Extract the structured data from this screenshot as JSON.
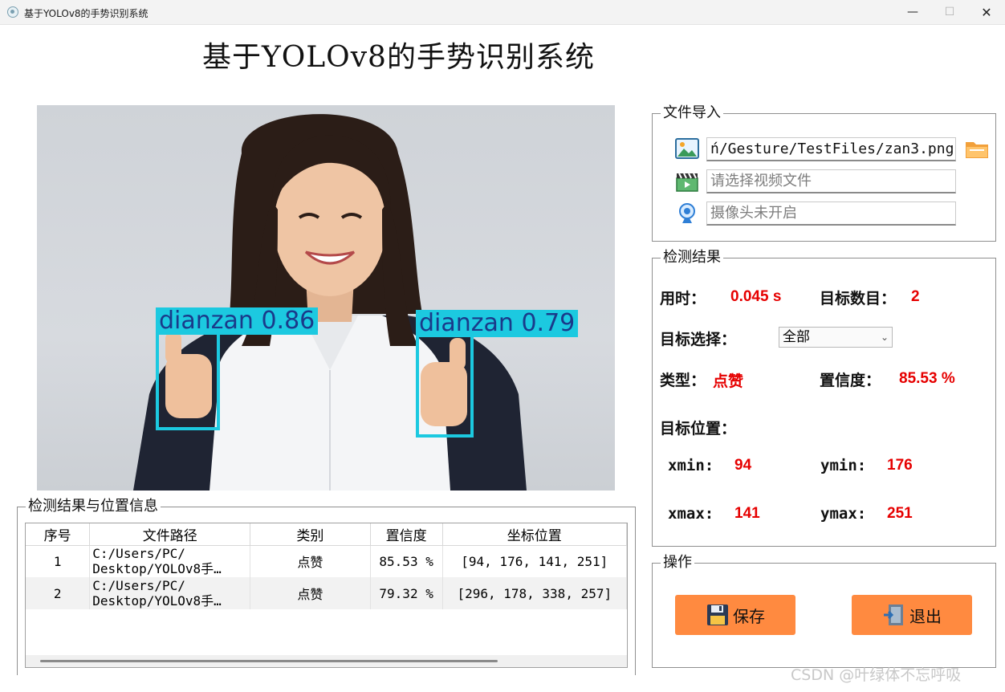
{
  "window": {
    "title": "基于YOLOv8的手势识别系统",
    "minimize": "—",
    "maximize": "☐",
    "close": "✕"
  },
  "header": {
    "title": "基于YOLOv8的手势识别系统"
  },
  "image": {
    "detections": [
      {
        "label": "dianzan 0.86"
      },
      {
        "label": "dianzan 0.79"
      }
    ],
    "accent_color": "#1cc9e0"
  },
  "file_import": {
    "title": "文件导入",
    "image_path": "ń/Gesture/TestFiles/zan3.png",
    "video_placeholder": "请选择视频文件",
    "camera_placeholder": "摄像头未开启",
    "icons": [
      "image-icon",
      "video-clapper-icon",
      "webcam-icon",
      "folder-icon"
    ]
  },
  "result": {
    "title": "检测结果",
    "time_label": "用时：",
    "time_value": "0.045 s",
    "count_label": "目标数目：",
    "count_value": "2",
    "select_label": "目标选择：",
    "select_value": "全部",
    "type_label": "类型：",
    "type_value": "点赞",
    "conf_label": "置信度：",
    "conf_value": "85.53 %",
    "pos_label": "目标位置：",
    "xmin_label": "xmin:",
    "xmin_value": "94",
    "ymin_label": "ymin:",
    "ymin_value": "176",
    "xmax_label": "xmax:",
    "xmax_value": "141",
    "ymax_label": "ymax:",
    "ymax_value": "251",
    "value_color": "#e60000"
  },
  "actions": {
    "title": "操作",
    "save_label": "保存",
    "exit_label": "退出",
    "button_color": "#ff8a40"
  },
  "table": {
    "title": "检测结果与位置信息",
    "headers": [
      "序号",
      "文件路径",
      "类别",
      "置信度",
      "坐标位置"
    ],
    "rows": [
      {
        "index": "1",
        "path": "C:/Users/PC/\nDesktop/YOLOv8手…",
        "class": "点赞",
        "conf": "85.53 %",
        "box": "[94, 176, 141, 251]"
      },
      {
        "index": "2",
        "path": "C:/Users/PC/\nDesktop/YOLOv8手…",
        "class": "点赞",
        "conf": "79.32 %",
        "box": "[296, 178, 338, 257]"
      }
    ]
  },
  "watermark": "CSDN @叶绿体不忘呼吸"
}
